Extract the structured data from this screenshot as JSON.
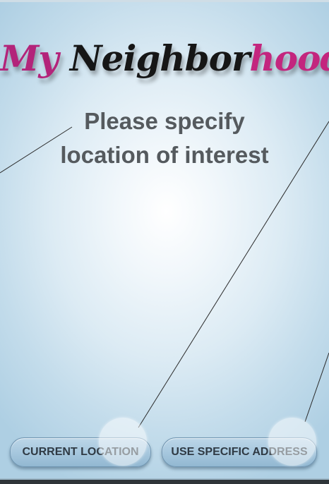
{
  "app": {
    "title_parts": [
      "My",
      "Neighbor",
      "hood"
    ]
  },
  "prompt": {
    "line1": "Please specify",
    "line2": "location of interest"
  },
  "buttons": {
    "current_location": "CURRENT LOCATION",
    "use_specific_address": "USE SPECIFIC ADDRESS"
  },
  "colors": {
    "brand_pink": "#b3247a",
    "logo_dark": "#161616",
    "prompt_text": "#555a5e",
    "button_fill": "#a9c9df",
    "background_center": "#ffffff",
    "background_edge": "#aecfe3"
  }
}
